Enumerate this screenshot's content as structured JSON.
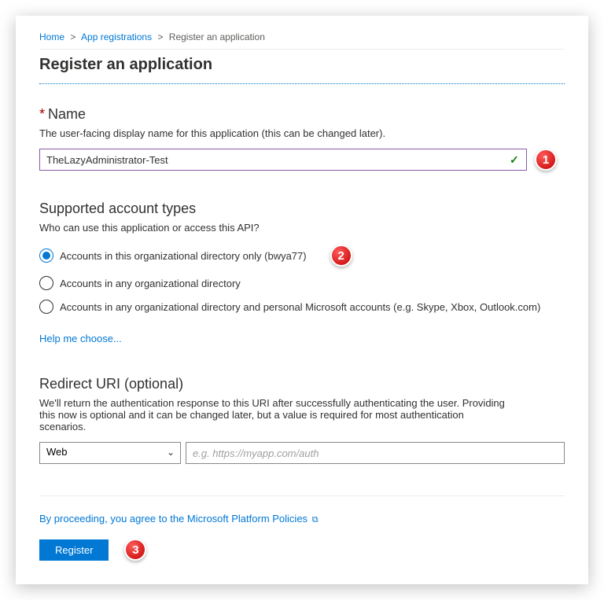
{
  "breadcrumb": {
    "home": "Home",
    "appreg": "App registrations",
    "current": "Register an application"
  },
  "pageTitle": "Register an application",
  "nameSection": {
    "label": "Name",
    "helper": "The user-facing display name for this application (this can be changed later).",
    "value": "TheLazyAdministrator-Test"
  },
  "callouts": {
    "one": "1",
    "two": "2",
    "three": "3"
  },
  "accountSection": {
    "title": "Supported account types",
    "helper": "Who can use this application or access this API?",
    "opt1": "Accounts in this organizational directory only (bwya77)",
    "opt2": "Accounts in any organizational directory",
    "opt3": "Accounts in any organizational directory and personal Microsoft accounts (e.g. Skype, Xbox, Outlook.com)",
    "helpLink": "Help me choose..."
  },
  "redirectSection": {
    "title": "Redirect URI (optional)",
    "helper": "We'll return the authentication response to this URI after successfully authenticating the user. Providing this now is optional and it can be changed later, but a value is required for most authentication scenarios.",
    "selectValue": "Web",
    "placeholder": "e.g. https://myapp.com/auth"
  },
  "footer": {
    "policy": "By proceeding, you agree to the Microsoft Platform Policies",
    "registerLabel": "Register"
  }
}
